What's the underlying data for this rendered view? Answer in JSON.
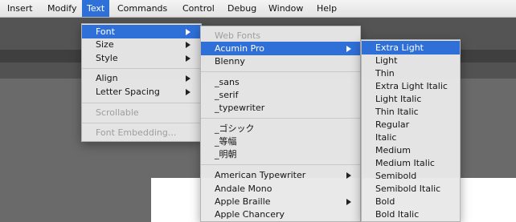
{
  "menubar": {
    "items": [
      "Insert",
      "Modify",
      "Text",
      "Commands",
      "Control",
      "Debug",
      "Window",
      "Help"
    ],
    "active_item": "Text"
  },
  "text_menu": {
    "items": [
      {
        "label": "Font"
      },
      {
        "label": "Size"
      },
      {
        "label": "Style"
      },
      {
        "label": "Align"
      },
      {
        "label": "Letter Spacing"
      },
      {
        "label": "Scrollable"
      },
      {
        "label": "Font Embedding..."
      }
    ]
  },
  "font_menu": {
    "items": [
      {
        "label": "Web Fonts"
      },
      {
        "label": "Acumin Pro"
      },
      {
        "label": "Blenny"
      },
      {
        "label": "_sans"
      },
      {
        "label": "_serif"
      },
      {
        "label": "_typewriter"
      },
      {
        "label": "_ゴシック"
      },
      {
        "label": "_等幅"
      },
      {
        "label": "_明朝"
      },
      {
        "label": "American Typewriter"
      },
      {
        "label": "Andale Mono"
      },
      {
        "label": "Apple Braille"
      },
      {
        "label": "Apple Chancery"
      }
    ]
  },
  "acumin_menu": {
    "items": [
      {
        "label": "Extra Light"
      },
      {
        "label": "Light"
      },
      {
        "label": "Thin"
      },
      {
        "label": "Extra Light Italic"
      },
      {
        "label": "Light Italic"
      },
      {
        "label": "Thin Italic"
      },
      {
        "label": "Regular"
      },
      {
        "label": "Italic"
      },
      {
        "label": "Medium"
      },
      {
        "label": "Medium Italic"
      },
      {
        "label": "Semibold"
      },
      {
        "label": "Semibold Italic"
      },
      {
        "label": "Bold"
      },
      {
        "label": "Bold Italic"
      }
    ]
  },
  "colors": {
    "selection": "#2f6fd8",
    "menu_bg": "#e8e8e8",
    "disabled_text": "#9e9e9e"
  }
}
